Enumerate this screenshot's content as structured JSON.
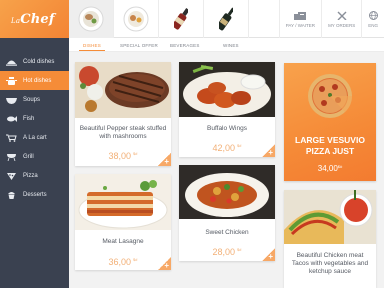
{
  "brand": {
    "prefix": "La",
    "name": "Chef"
  },
  "sidebar": {
    "items": [
      {
        "label": "Cold dishes",
        "icon": "plate-cover-icon",
        "active": false
      },
      {
        "label": "Hot dishes",
        "icon": "pot-icon",
        "active": true
      },
      {
        "label": "Soups",
        "icon": "bowl-icon",
        "active": false
      },
      {
        "label": "Fish",
        "icon": "fish-icon",
        "active": false
      },
      {
        "label": "A La cart",
        "icon": "cart-icon",
        "active": false
      },
      {
        "label": "Grill",
        "icon": "grill-icon",
        "active": false
      },
      {
        "label": "Pizza",
        "icon": "pizza-icon",
        "active": false
      },
      {
        "label": "Desserts",
        "icon": "cupcake-icon",
        "active": false
      }
    ]
  },
  "categories": [
    {
      "label": "DISHES",
      "active": true
    },
    {
      "label": "SPECIAL OFFER",
      "active": false
    },
    {
      "label": "BEVERAGES",
      "active": false
    },
    {
      "label": "WINES",
      "active": false
    }
  ],
  "top_actions": [
    {
      "label": "PAY / WAITER",
      "icon": "waiter-icon"
    },
    {
      "label": "MY ORDERS",
      "icon": "cutlery-icon"
    },
    {
      "label": "ENG",
      "icon": "globe-icon"
    }
  ],
  "cards": [
    {
      "name": "Beautiful Pepper steak stuffed with mashrooms",
      "price": "38,00",
      "currency": "$#"
    },
    {
      "name": "Buffalo Wings",
      "price": "42,00",
      "currency": "$#"
    },
    {
      "name": "Meat Lasagne",
      "price": "36,00",
      "currency": "$#"
    },
    {
      "name": "Sweet Chicken",
      "price": "28,00",
      "currency": "$#"
    },
    {
      "name": "Beautiful Chicken meat Tacos with vegetables and ketchup sauce",
      "price": "",
      "currency": ""
    }
  ],
  "promo": {
    "title": "LARGE VESUVIO PIZZA JUST",
    "price": "34,00",
    "currency": "$#"
  },
  "add_button_label": "+",
  "colors": {
    "accent": "#f58c38",
    "sidebar": "#3a4150",
    "price": "#f2b077"
  }
}
